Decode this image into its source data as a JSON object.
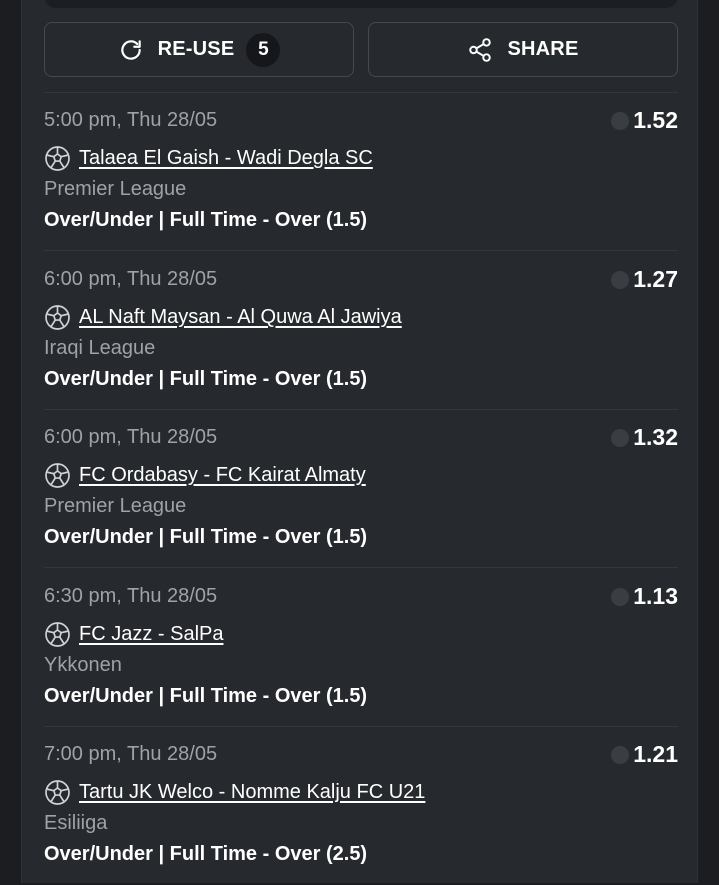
{
  "actions": {
    "reuse_label": "RE-USE",
    "reuse_count": "5",
    "share_label": "SHARE"
  },
  "bets": [
    {
      "datetime": "5:00 pm, Thu 28/05",
      "odds": "1.52",
      "match": "Talaea El Gaish - Wadi Degla SC",
      "league": "Premier League",
      "market": "Over/Under | Full Time - Over (1.5)"
    },
    {
      "datetime": "6:00 pm, Thu 28/05",
      "odds": "1.27",
      "match": "AL Naft Maysan - Al Quwa Al Jawiya",
      "league": "Iraqi League",
      "market": "Over/Under | Full Time - Over (1.5)"
    },
    {
      "datetime": "6:00 pm, Thu 28/05",
      "odds": "1.32",
      "match": "FC Ordabasy - FC Kairat Almaty",
      "league": "Premier League",
      "market": "Over/Under | Full Time - Over (1.5)"
    },
    {
      "datetime": "6:30 pm, Thu 28/05",
      "odds": "1.13",
      "match": "FC Jazz - SalPa",
      "league": "Ykkonen",
      "market": "Over/Under | Full Time - Over (1.5)"
    },
    {
      "datetime": "7:00 pm, Thu 28/05",
      "odds": "1.21",
      "match": "Tartu JK Welco - Nomme Kalju FC U21",
      "league": "Esiliiga",
      "market": "Over/Under | Full Time - Over (2.5)"
    }
  ],
  "icons": {
    "reuse": "refresh-icon",
    "share": "share-icon",
    "sport": "soccer-ball-icon"
  }
}
